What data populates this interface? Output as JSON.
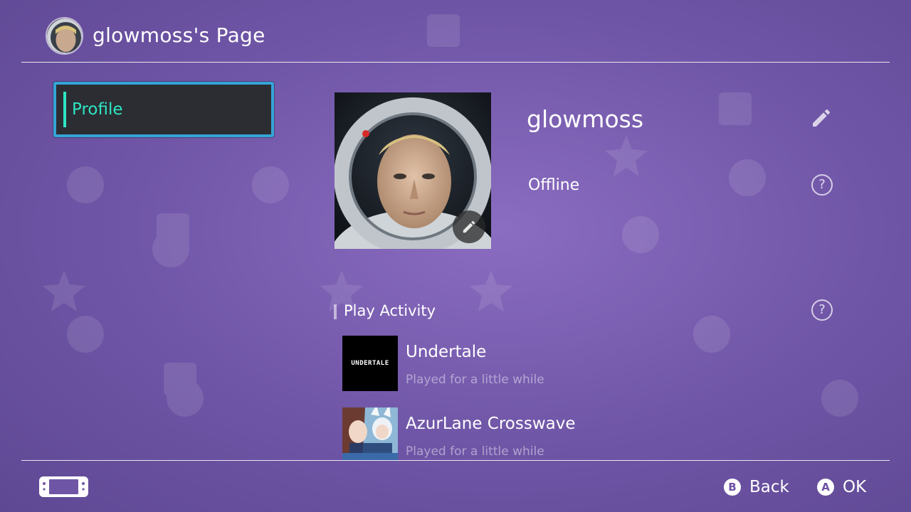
{
  "header": {
    "title": "glowmoss's Page"
  },
  "sidebar": {
    "items": [
      {
        "label": "Profile",
        "selected": true
      }
    ]
  },
  "profile": {
    "username": "glowmoss",
    "status": "Offline",
    "help_glyph": "?"
  },
  "activity": {
    "section_title": "Play Activity",
    "help_glyph": "?",
    "games": [
      {
        "title": "Undertale",
        "subtitle": "Played for a little while",
        "logo_text": "UNDERTALE"
      },
      {
        "title": "AzurLane Crosswave",
        "subtitle": "Played for a little while"
      }
    ]
  },
  "footer": {
    "back": {
      "key": "B",
      "label": "Back"
    },
    "ok": {
      "key": "A",
      "label": "OK"
    }
  },
  "colors": {
    "background": "#6f55a6",
    "selection_border": "#35a4d6",
    "selection_accent": "#2ee6c4",
    "sidebar_item_bg": "#2b2d32"
  },
  "icons": {
    "edit": "pencil-icon",
    "help": "question-icon",
    "console": "handheld-console-icon"
  }
}
